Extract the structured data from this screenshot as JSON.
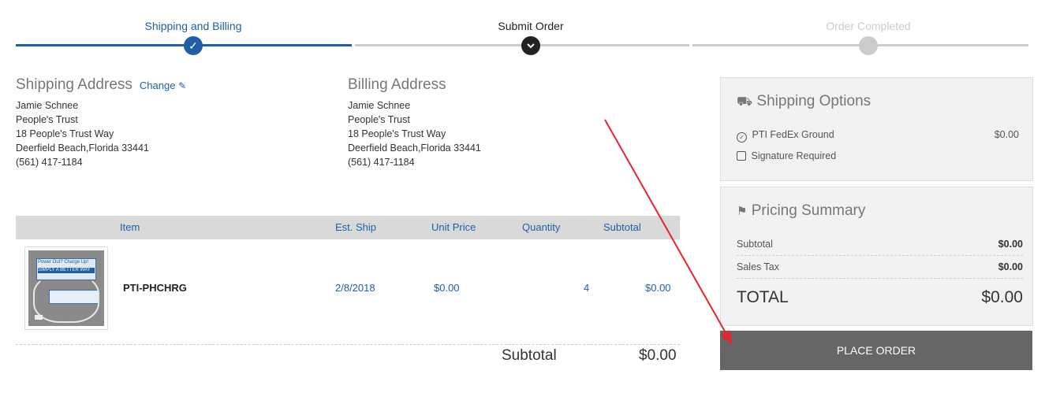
{
  "steps": [
    {
      "label": "Shipping and Billing",
      "state": "done"
    },
    {
      "label": "Submit Order",
      "state": "current"
    },
    {
      "label": "Order Completed",
      "state": "pending"
    }
  ],
  "shipping": {
    "title": "Shipping Address",
    "change_label": "Change",
    "lines": [
      "Jamie Schnee",
      "People's Trust",
      "18 People's Trust Way",
      "Deerfield Beach,Florida 33441",
      "(561) 417-1184"
    ]
  },
  "billing": {
    "title": "Billing Address",
    "lines": [
      "Jamie Schnee",
      "People's Trust",
      "18 People's Trust Way",
      "Deerfield Beach,Florida 33441",
      "(561) 417-1184"
    ]
  },
  "table": {
    "headers": {
      "item": "Item",
      "est_ship": "Est. Ship",
      "unit_price": "Unit Price",
      "quantity": "Quantity",
      "subtotal": "Subtotal"
    },
    "rows": [
      {
        "sku": "PTI-PHCHRG",
        "est_ship": "2/8/2018",
        "unit_price": "$0.00",
        "quantity": "4",
        "subtotal": "$0.00",
        "thumb_text": [
          "Power Out? Charge Up!",
          "SIMPLY A BETTER WAY"
        ]
      }
    ],
    "footer_label": "Subtotal",
    "footer_value": "$0.00"
  },
  "shipping_options": {
    "title": "Shipping Options",
    "selected": {
      "label": "PTI FedEx Ground",
      "price": "$0.00"
    },
    "signature_label": "Signature Required"
  },
  "pricing_summary": {
    "title": "Pricing Summary",
    "subtotal_label": "Subtotal",
    "subtotal_value": "$0.00",
    "tax_label": "Sales Tax",
    "tax_value": "$0.00",
    "total_label": "TOTAL",
    "total_value": "$0.00"
  },
  "place_order_label": "PLACE ORDER",
  "colors": {
    "accent": "#1f5fa8",
    "dark": "#222222",
    "pending": "#cccccc",
    "button": "#666666",
    "annotation": "#e8242b"
  }
}
